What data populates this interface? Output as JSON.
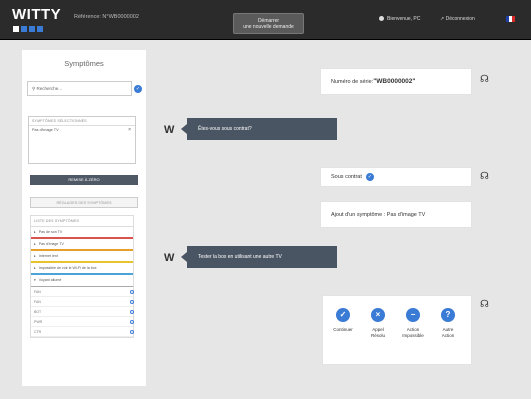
{
  "header": {
    "logo": "WITTY",
    "reference": "Référence: N°WB0000002",
    "start_button_line1": "Démarrer",
    "start_button_line2": "une nouvelle demande",
    "user": "Bienvenue, PC",
    "logout": "Déconnexion",
    "flag_colors": [
      "#1f3fa8",
      "#ffffff",
      "#d62828"
    ]
  },
  "sidebar": {
    "title": "Symptômes",
    "search_placeholder": "Recherche...",
    "selected_header": "SYMPTÔMES SÉLECTIONNÉS",
    "selected_items": [
      "Pas d'image TV"
    ],
    "remove_glyph": "×",
    "reset_label": "REMISE À ZÉRO",
    "settings_label": "RÉGLAGES DES SYMPTÔMES",
    "list_header": "LISTE DES SYMPTÔMES",
    "symptoms": [
      {
        "label": "Pas de son TV",
        "color": "#d9534f"
      },
      {
        "label": "Pas d'image TV",
        "color": "#e8a02c"
      },
      {
        "label": "Internet lent",
        "color": "#e8c42c"
      },
      {
        "label": "Impossible de voir le Wi-Fi de la box",
        "color": "#4ba3d6"
      },
      {
        "label": "Voyant allumé",
        "color": "#aaaaaa"
      }
    ],
    "sub_items": [
      "FAN",
      "FAN",
      "BOT",
      "PWR",
      "CTR"
    ]
  },
  "chat": {
    "serial_label": "Numéro de série: ",
    "serial_value": "\"WB0000002\"",
    "question1": "Êtes-vous sous contrat?",
    "answer1": "Sous contrat",
    "symptom_added": "Ajout d'un symptôme : Pas d'image TV",
    "question2": "Tester la box en utilisant une autre TV",
    "bot_label": "W",
    "headset_glyph": "☊"
  },
  "actions": [
    {
      "icon": "✓",
      "label1": "Continuer",
      "label2": ""
    },
    {
      "icon": "×",
      "label1": "Appel",
      "label2": "Résolu"
    },
    {
      "icon": "−",
      "label1": "Action",
      "label2": "Impossible"
    },
    {
      "icon": "?",
      "label1": "Autre",
      "label2": "Action"
    }
  ]
}
